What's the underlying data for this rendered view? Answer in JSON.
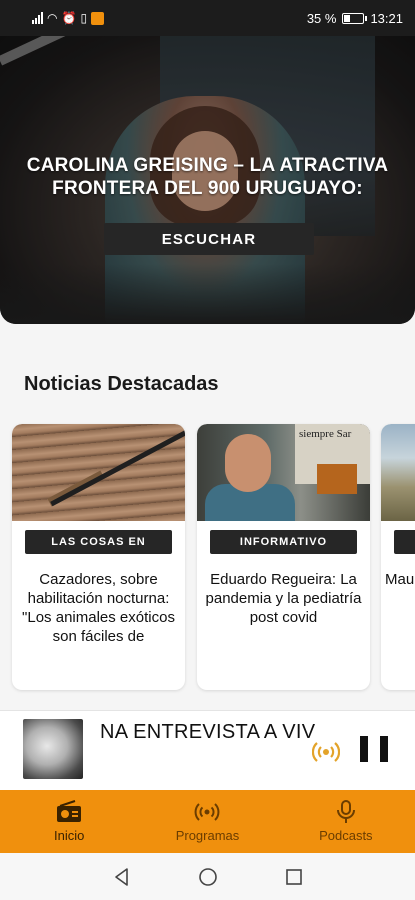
{
  "status_bar": {
    "battery_percent": "35 %",
    "battery_level": 0.35,
    "time": "13:21"
  },
  "hero": {
    "title": "CAROLINA GREISING – LA ATRACTIVA FRONTERA DEL 900 URUGUAYO:",
    "button_label": "ESCUCHAR"
  },
  "featured": {
    "section_title": "Noticias Destacadas",
    "cards": [
      {
        "tag": "LAS COSAS EN",
        "headline": "Cazadores, sobre habilitación nocturna: \"Los animales exóticos son fáciles de",
        "image": "rifle-on-wood-photo"
      },
      {
        "tag": "INFORMATIVO",
        "headline": "Eduardo Regueira: La pandemia y la pediatría post covid",
        "image": "studio-guest-photo",
        "image_sign": "siempre Sar"
      },
      {
        "tag": "",
        "headline": "Mau Aso \"H erro",
        "image": "field-photo"
      }
    ]
  },
  "player": {
    "now_playing": "NA ENTREVISTA A VIVI",
    "live_icon": "broadcast-icon",
    "pause_icon": "pause-icon"
  },
  "bottom_nav": {
    "items": [
      {
        "label": "Inicio",
        "icon": "radio-icon",
        "active": true
      },
      {
        "label": "Programas",
        "icon": "broadcast-icon",
        "active": false
      },
      {
        "label": "Podcasts",
        "icon": "microphone-icon",
        "active": false
      }
    ]
  },
  "colors": {
    "accent": "#f0900d",
    "dark": "#262626",
    "nav_text": "#6b3d00"
  }
}
